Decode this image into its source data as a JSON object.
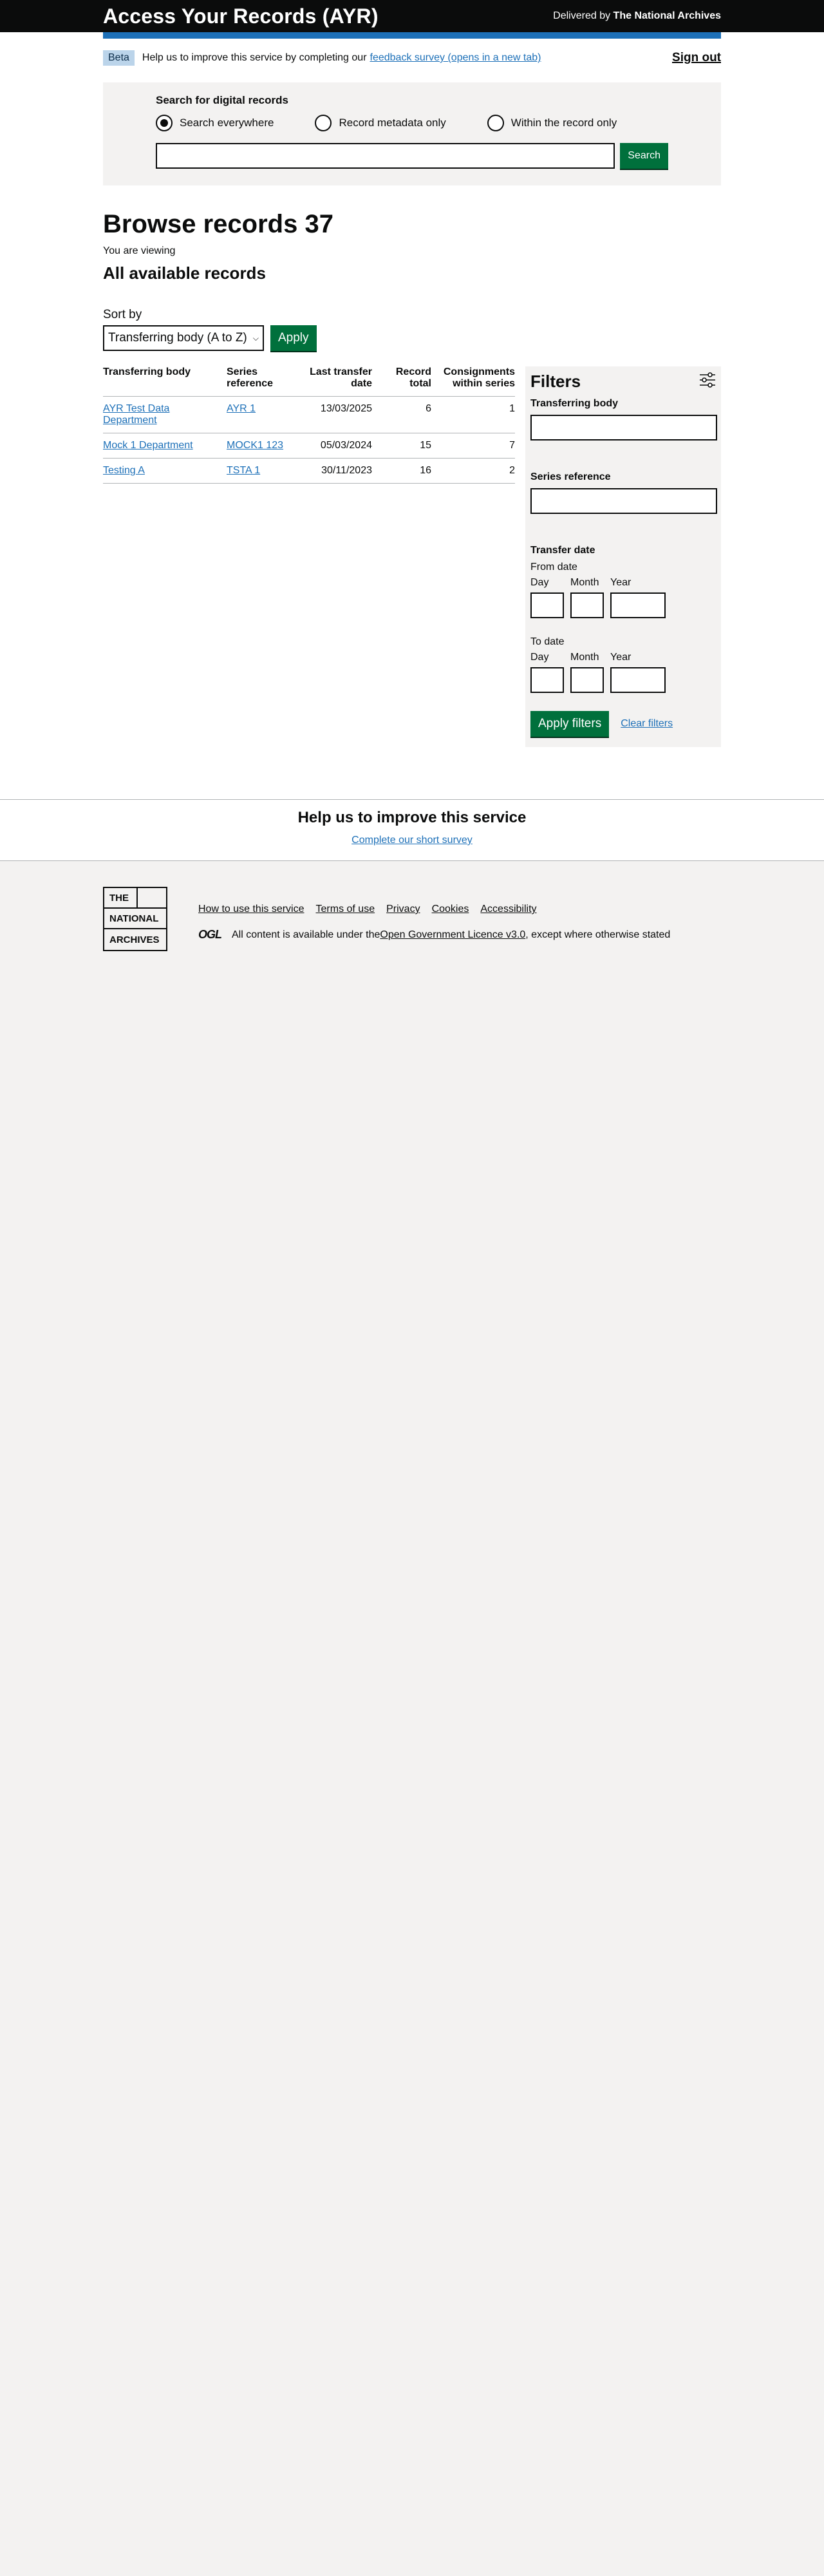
{
  "header": {
    "service_name": "Access Your Records (AYR)",
    "delivered_prefix": "Delivered by ",
    "delivered_org": "The National Archives"
  },
  "phase": {
    "tag": "Beta",
    "text": "Help us to improve this service by completing our",
    "link": "feedback survey (opens in a new tab)",
    "sign_out": "Sign out"
  },
  "search": {
    "heading": "Search for digital records",
    "options": [
      "Search everywhere",
      "Record metadata only",
      "Within the record only"
    ],
    "selected_option": "Search everywhere",
    "input_value": "",
    "button": "Search"
  },
  "browse": {
    "title": "Browse records 37",
    "viewing_label": "You are viewing",
    "subtitle": "All available records",
    "sort_label": "Sort by",
    "sort_value": "Transferring body (A to Z)",
    "apply_label": "Apply"
  },
  "table": {
    "headers": [
      "Transferring body",
      "Series reference",
      "Last transfer date",
      "Record total",
      "Consignments within series"
    ],
    "rows": [
      {
        "body": "AYR Test Data Department",
        "series": "AYR 1",
        "date": "13/03/2025",
        "total": "6",
        "consignments": "1"
      },
      {
        "body": "Mock 1 Department",
        "series": "MOCK1 123",
        "date": "05/03/2024",
        "total": "15",
        "consignments": "7"
      },
      {
        "body": "Testing A",
        "series": "TSTA 1",
        "date": "30/11/2023",
        "total": "16",
        "consignments": "2"
      }
    ]
  },
  "filters": {
    "title": "Filters",
    "transferring_body_label": "Transferring body",
    "series_reference_label": "Series reference",
    "transfer_date_label": "Transfer date",
    "from_label": "From date",
    "to_label": "To date",
    "day": "Day",
    "month": "Month",
    "year": "Year",
    "apply": "Apply filters",
    "clear": "Clear filters"
  },
  "improve": {
    "title": "Help us to improve this service",
    "link": "Complete our short survey"
  },
  "footer": {
    "logo_lines": [
      "THE",
      "NATIONAL",
      "ARCHIVES"
    ],
    "links": [
      "How to use this service",
      "Terms of use",
      "Privacy",
      "Cookies",
      "Accessibility"
    ],
    "ogl": "OGL",
    "licence_prefix": "All content is available under the ",
    "licence_link": "Open Government Licence v3.0",
    "licence_suffix": ", except where otherwise stated"
  },
  "colors": {
    "header_bg": "#0b0c0c",
    "brand_blue": "#1d70b8",
    "button_green": "#00703c",
    "page_bg": "#f3f2f1",
    "tag_bg": "#bbd4ea"
  }
}
